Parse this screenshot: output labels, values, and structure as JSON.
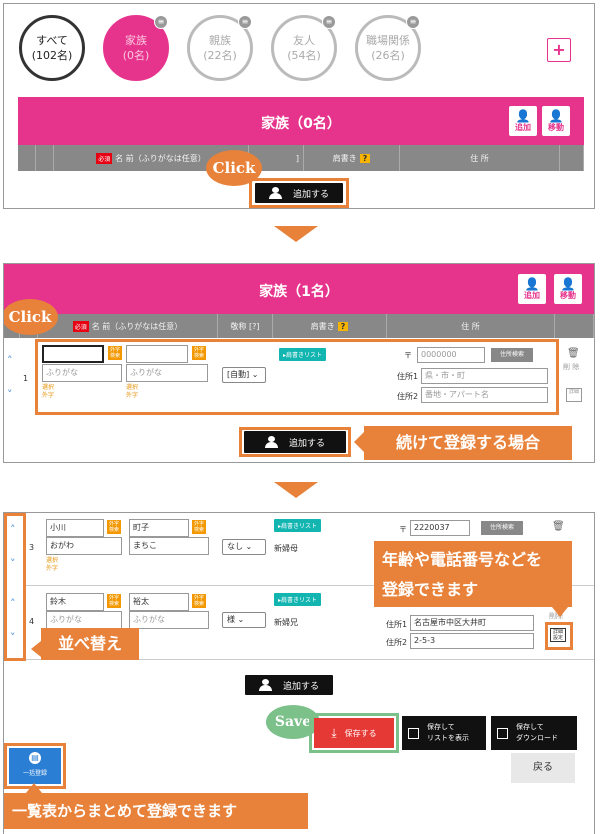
{
  "panel1": {
    "groups": [
      {
        "name": "すべて",
        "count": "(102名)",
        "badge": ""
      },
      {
        "name": "家族",
        "count": "(0名)",
        "badge": "≡"
      },
      {
        "name": "親族",
        "count": "(22名)",
        "badge": "≡"
      },
      {
        "name": "友人",
        "count": "(54名)",
        "badge": "≡"
      },
      {
        "name": "職場関係",
        "count": "(26名)",
        "badge": "≡"
      }
    ],
    "plus": "+",
    "title": "家族（0名）",
    "add_icon_label": "追加",
    "move_icon_label": "移動",
    "columns": {
      "required": "必須",
      "name": "名 前（ふりがなは任意）",
      "title_col": "]",
      "address_label": "肩書き",
      "qmark": "?",
      "address": "住 所"
    },
    "click": "Click",
    "add_button": "追加する"
  },
  "panel2": {
    "title": "家族（1名）",
    "add_icon_label": "追加",
    "move_icon_label": "移動",
    "columns": {
      "required": "必須",
      "name": "名 前（ふりがなは任意）",
      "honorific": "敬称 [?]",
      "title_col": "肩書き",
      "qmark": "?",
      "address": "住 所"
    },
    "click": "Click",
    "row_number": "1",
    "last_name": {
      "value": "",
      "furigana_placeholder": "ふりがな",
      "kanji_btn": "外字検索",
      "note": "選択外字"
    },
    "first_name": {
      "value": "",
      "furigana_placeholder": "ふりがな",
      "kanji_btn": "外字検索",
      "note": "選択外字"
    },
    "honorific": "[自動]",
    "title_list_btn": "▸肩書きリスト",
    "zip_mark": "〒",
    "zip_placeholder": "0000000",
    "zip_search": "住所検索",
    "addr1_label": "住所1",
    "addr1_placeholder": "県・市・町",
    "addr2_label": "住所2",
    "addr2_placeholder": "番地・アパート名",
    "delete_label": "削 除",
    "detail_label": "詳細",
    "add_button": "追加する",
    "callout": "続けて登録する場合"
  },
  "panel3": {
    "rows": [
      {
        "num": "3",
        "last": "小川",
        "last_furi": "おがわ",
        "first": "町子",
        "first_furi": "まちこ",
        "honorific": "なし",
        "title_btn": "▸肩書きリスト",
        "title": "新婦母",
        "zip": "2220037",
        "note1": "選択",
        "note2": "外字"
      },
      {
        "num": "4",
        "last": "鈴木",
        "last_furi": "ふりがな",
        "first": "裕太",
        "first_furi": "ふりがな",
        "honorific": "様",
        "title_btn": "▸肩書きリスト",
        "title": "新婦兄",
        "addr1_label": "住所1",
        "addr1": "名古屋市中区大井町",
        "addr2_label": "住所2",
        "addr2": "2-5-3"
      }
    ],
    "kanji_btn": "外字検索",
    "zip_mark": "〒",
    "zip_search": "住所検索",
    "delete_label": "削除",
    "detail_label": "詳細設定",
    "callout_detail_line1": "年齢や電話番号などを",
    "callout_detail_line2": "登録できます",
    "callout_sort": "並べ替え",
    "add_button": "追加する",
    "save_bubble": "Save",
    "save_button": "保存する",
    "save_list_line1": "保存して",
    "save_list_line2": "リストを表示",
    "save_dl_line1": "保存して",
    "save_dl_line2": "ダウンロード",
    "bulk_label": "一括登録",
    "back_button": "戻る",
    "callout_bulk": "一覧表からまとめて登録できます"
  },
  "colors": {
    "pink": "#e6348c",
    "orange": "#e8823a",
    "red_button": "#e53935",
    "teal": "#13b5b1",
    "green": "#7cc08a",
    "blue": "#2a7fd4"
  }
}
